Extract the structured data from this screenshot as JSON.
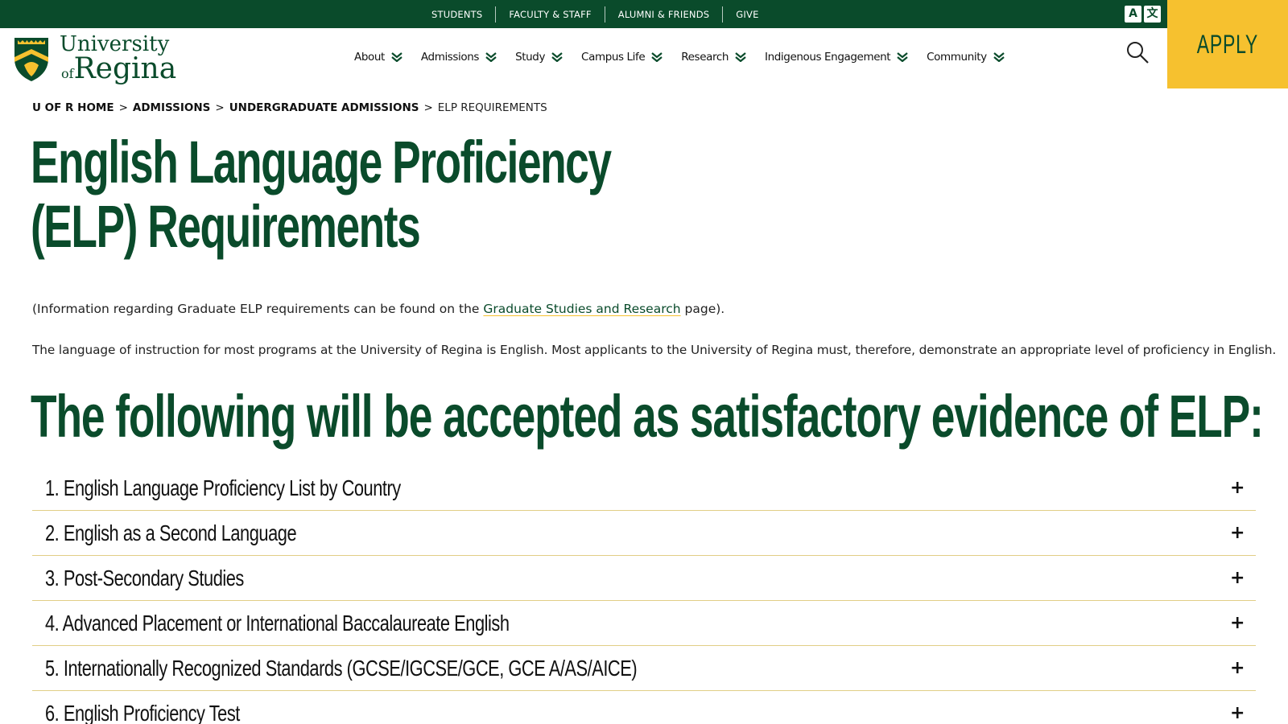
{
  "utility_nav": {
    "links": [
      "STUDENTS",
      "FACULTY & STAFF",
      "ALUMNI & FRIENDS",
      "GIVE"
    ],
    "translate_icon": "translate-icon"
  },
  "apply_button": {
    "label": "APPLY"
  },
  "logo": {
    "line1": "University",
    "line2": "of",
    "line3": "Regina"
  },
  "main_nav": {
    "items": [
      "About",
      "Admissions",
      "Study",
      "Campus Life",
      "Research",
      "Indigenous Engagement",
      "Community"
    ]
  },
  "breadcrumb": {
    "items": [
      "U OF R HOME",
      "ADMISSIONS",
      "UNDERGRADUATE ADMISSIONS"
    ],
    "separator": ">",
    "current": "ELP REQUIREMENTS"
  },
  "page_title": "English Language Proficiency (ELP) Requirements",
  "intro": {
    "prefix": "(Information regarding Graduate ELP requirements can be found on the ",
    "link": "Graduate Studies and Research",
    "suffix": " page)."
  },
  "lead": "The language of instruction for most programs at the University of Regina is English. Most applicants to the University of Regina must, therefore, demonstrate an appropriate level of proficiency in English.",
  "section_heading": "The following will be accepted as satisfactory evidence of ELP:",
  "accordion": {
    "items": [
      "1. English Language Proficiency List by Country",
      "2. English as a Second Language",
      "3. Post-Secondary Studies",
      "4. Advanced Placement or International Baccalaureate English",
      "5. Internationally Recognized Standards (GCSE/IGCSE/GCE, GCE A/AS/AICE)",
      "6. English Proficiency Test"
    ],
    "expand_symbol": "+"
  },
  "colors": {
    "brand_green": "#0a4b2b",
    "brand_gold": "#f6c12f"
  }
}
